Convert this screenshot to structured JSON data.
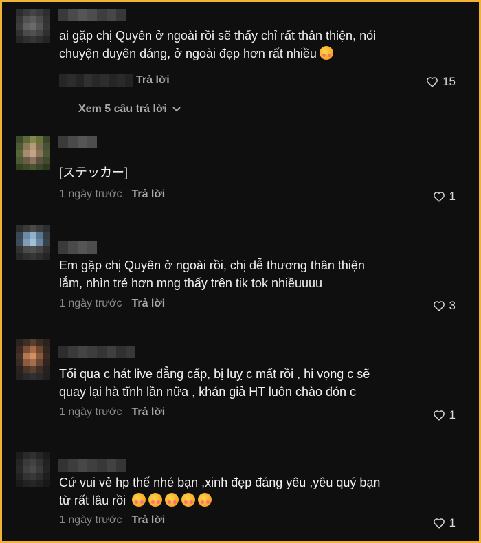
{
  "comments": [
    {
      "text": "ai gặp chị Quyên ở ngoài rồi sẽ thấy chỉ rất thân thiện, nói\nchuyện duyên dáng, ở ngoài đẹp hơn rất nhiều",
      "emoji_count": 1,
      "time": "",
      "reply_label": "Trả lời",
      "likes": "15",
      "view_replies": "Xem 5 câu trả lời"
    },
    {
      "text": "[ステッカー]",
      "emoji_count": 0,
      "time": "1 ngày trước",
      "reply_label": "Trả lời",
      "likes": "1"
    },
    {
      "text": "Em gặp chị Quyên ở ngoài rồi, chị dễ thương thân thiện\nlắm, nhìn trẻ hơn mng thấy trên tik tok nhiềuuuu",
      "emoji_count": 0,
      "time": "1 ngày trước",
      "reply_label": "Trả lời",
      "likes": "3"
    },
    {
      "text": "Tối qua c hát live đẳng cấp, bị luỵ c mất rồi , hi vọng c sẽ\nquay lại hà tĩnh lần nữa , khán giả HT luôn chào đón c",
      "emoji_count": 0,
      "time": "1 ngày trước",
      "reply_label": "Trả lời",
      "likes": "1"
    },
    {
      "text": "Cứ vui vẻ hp thế nhé bạn ,xinh đẹp đáng yêu ,yêu quý bạn\ntừ rất lâu rồi",
      "emoji_count": 5,
      "time": "1 ngày trước",
      "reply_label": "Trả lời",
      "likes": "1"
    }
  ],
  "colors": {
    "background": "#0f0f0f",
    "border": "#f2b233",
    "text": "#f2f2f2",
    "muted": "#8a8a8a"
  },
  "icons": {
    "like": "heart-outline-icon",
    "expand": "chevron-down-icon",
    "emoji": "smiling-face-with-hearts-emoji"
  }
}
